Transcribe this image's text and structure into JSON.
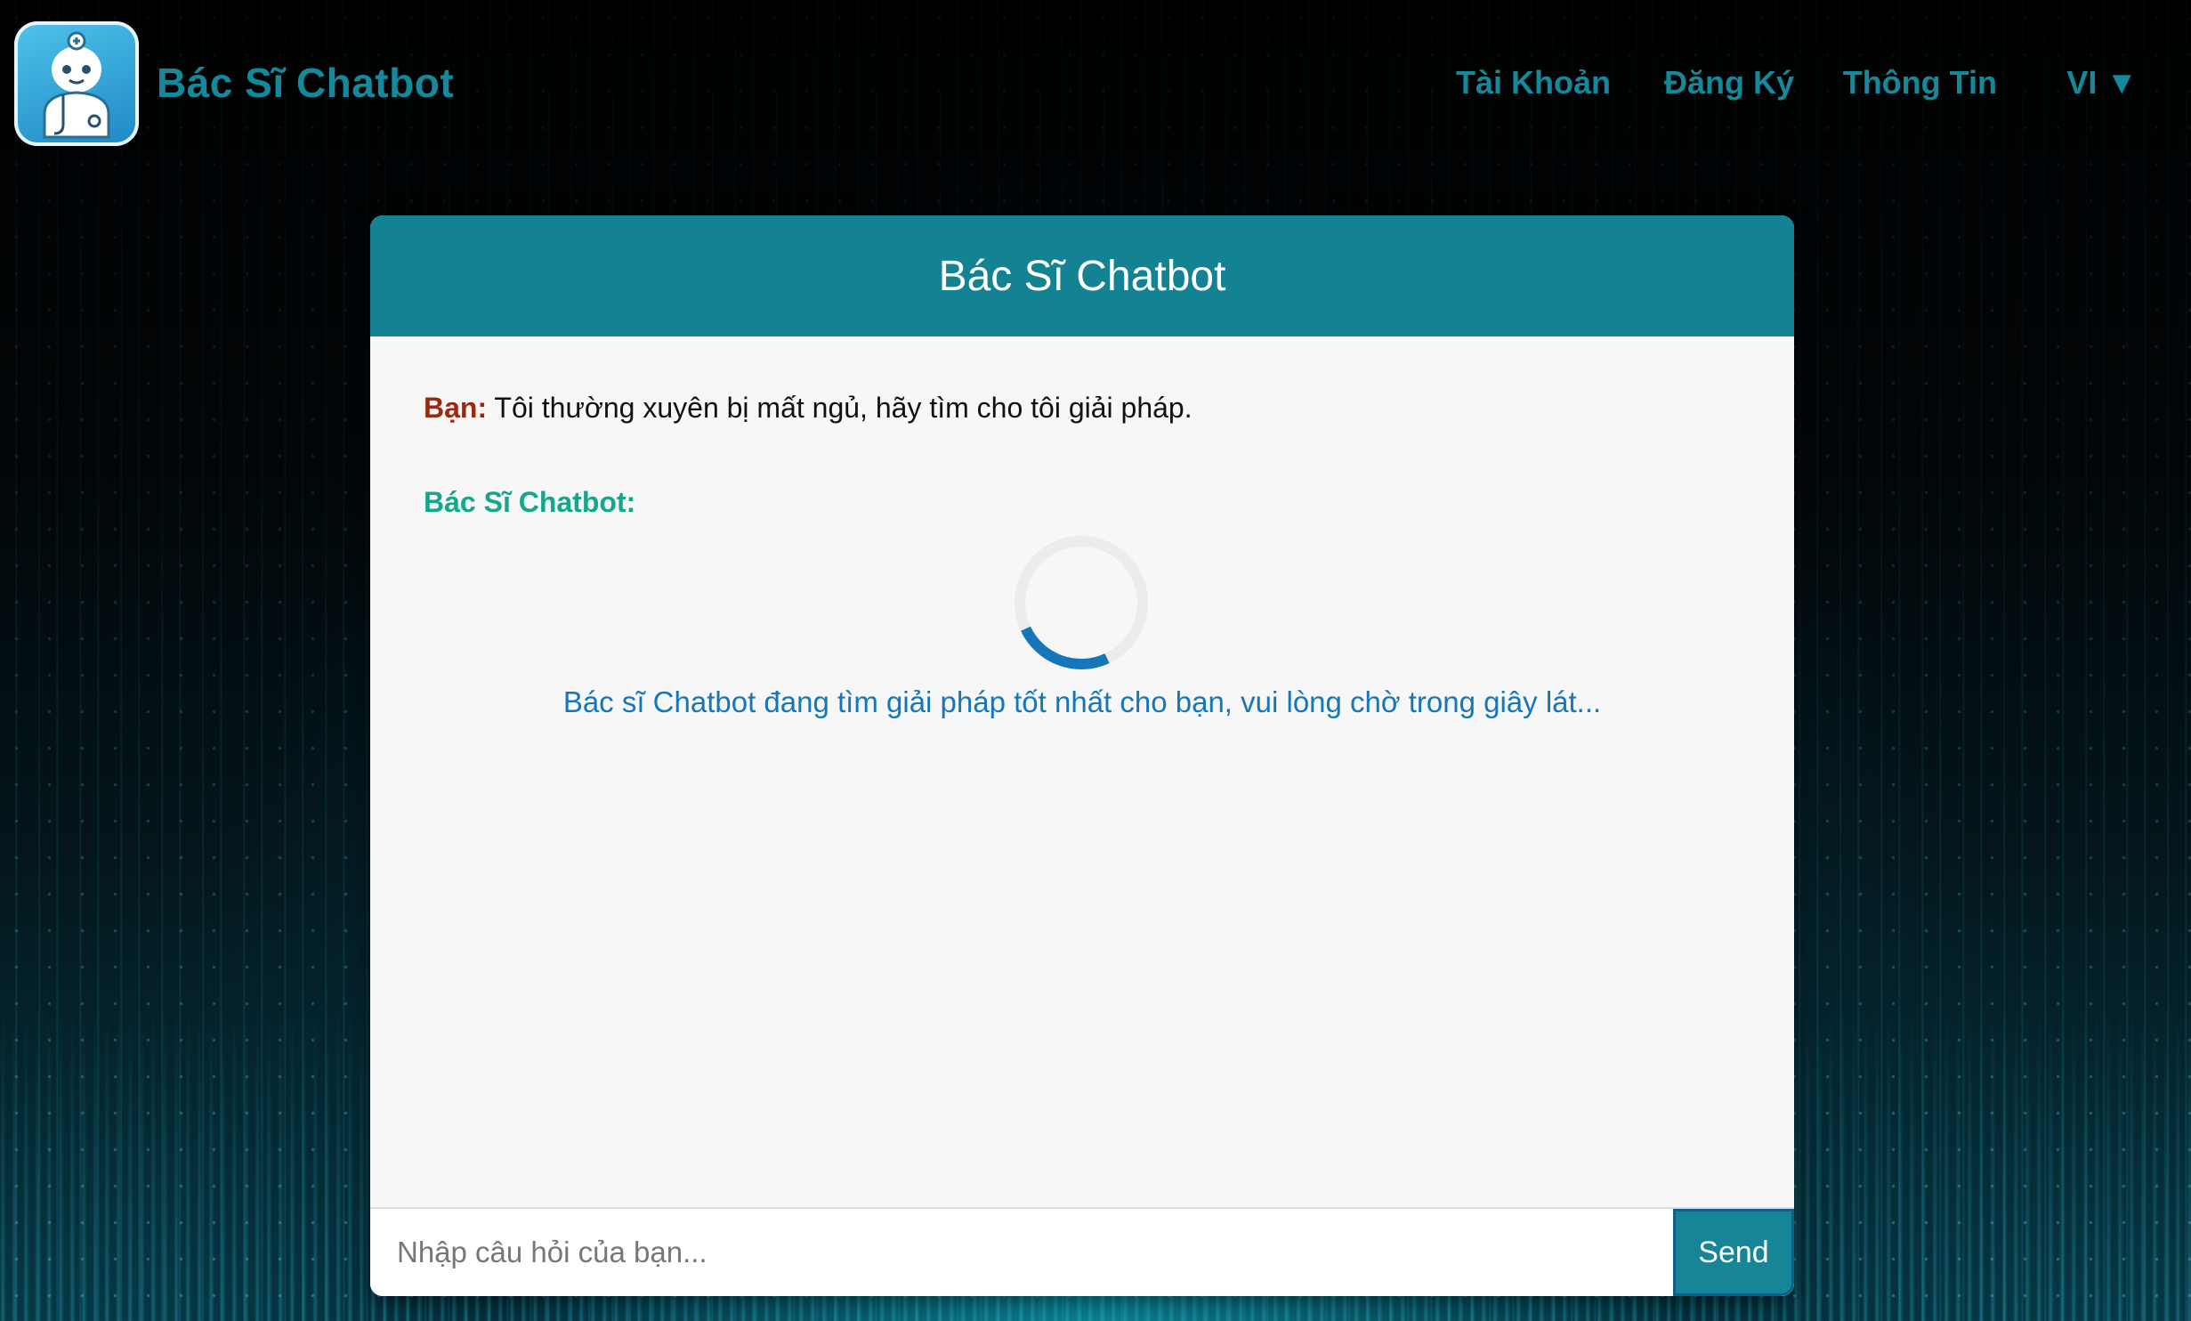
{
  "header": {
    "brand": "Bác Sĩ Chatbot",
    "nav": [
      {
        "label": "Tài Khoản"
      },
      {
        "label": "Đăng Ký"
      },
      {
        "label": "Thông Tin"
      },
      {
        "label": "VI ▼"
      }
    ]
  },
  "chat": {
    "title": "Bác Sĩ Chatbot",
    "user_label": "Bạn:",
    "user_message": " Tôi thường xuyên bị mất ngủ, hãy tìm cho tôi giải pháp.",
    "bot_label": "Bác Sĩ Chatbot:",
    "loading_text": "Bác sĩ Chatbot đang tìm giải pháp tốt nhất cho bạn, vui lòng chờ trong giây lát..."
  },
  "input": {
    "placeholder": "Nhập câu hỏi của bạn...",
    "value": "",
    "send_label": "Send"
  },
  "colors": {
    "accent": "#138394",
    "brand_text": "#138a9c",
    "user_label": "#9a2a0e",
    "bot_label": "#14a88a",
    "loading": "#1677b8"
  },
  "icons": {
    "logo": "doctor-robot-icon",
    "language_dropdown": "triangle-down-icon",
    "spinner": "loading-spinner-icon"
  }
}
